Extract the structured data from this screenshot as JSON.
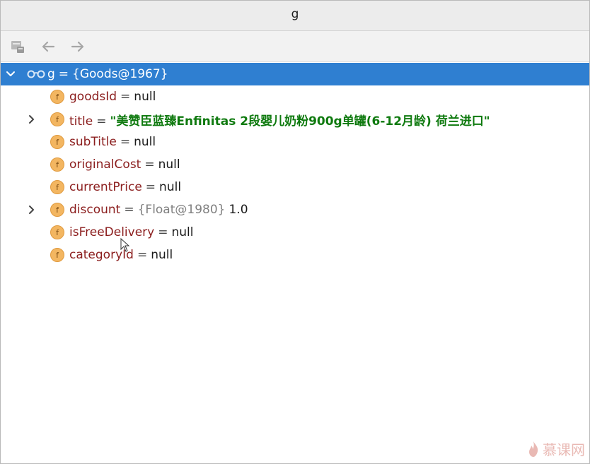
{
  "window": {
    "title": "g"
  },
  "toolbar": {
    "icons": [
      "object-view-icon",
      "back-arrow-icon",
      "forward-arrow-icon"
    ]
  },
  "tree": {
    "root": {
      "name": "g",
      "op": "=",
      "value": "{Goods@1967}",
      "expanded": true
    },
    "fields": [
      {
        "name": "goodsId",
        "op": "=",
        "value": "null",
        "expandable": false
      },
      {
        "name": "title",
        "op": "=",
        "value": "\"美赞臣蓝臻Enfinitas 2段婴儿奶粉900g单罐(6-12月龄) 荷兰进口\"",
        "expandable": true,
        "kind": "string"
      },
      {
        "name": "subTitle",
        "op": "=",
        "value": "null",
        "expandable": false
      },
      {
        "name": "originalCost",
        "op": "=",
        "value": "null",
        "expandable": false
      },
      {
        "name": "currentPrice",
        "op": "=",
        "value": "null",
        "expandable": false
      },
      {
        "name": "discount",
        "op": "=",
        "type": "{Float@1980}",
        "value": "1.0",
        "expandable": true
      },
      {
        "name": "isFreeDelivery",
        "op": "=",
        "value": "null",
        "expandable": false
      },
      {
        "name": "categoryId",
        "op": "=",
        "value": "null",
        "expandable": false
      }
    ],
    "field_icon_letter": "f"
  },
  "watermark": {
    "text": "慕课网"
  },
  "colors": {
    "selection": "#2f7fd1",
    "field_name": "#8b1d1d",
    "string_value": "#0f7a0f",
    "field_icon": "#f3b661"
  }
}
